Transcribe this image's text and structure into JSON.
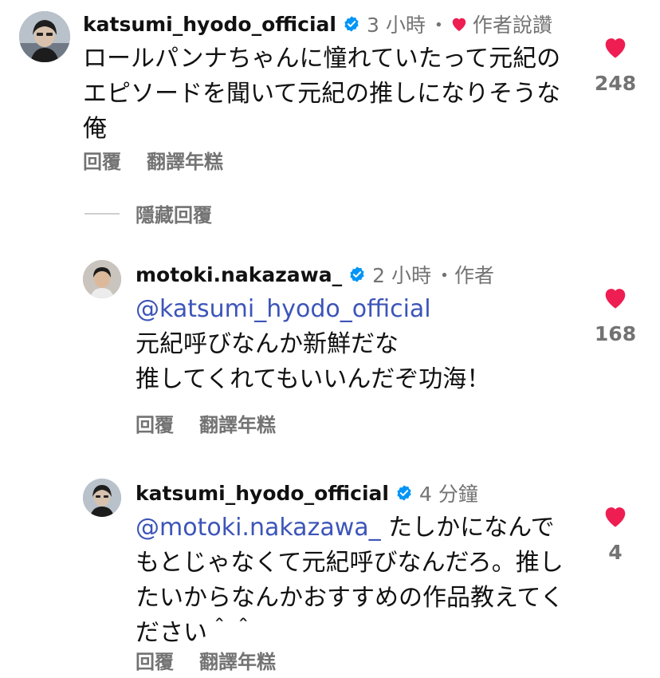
{
  "colors": {
    "heart": "#ee1d52",
    "verified": "#0095f6",
    "mention": "#3d55b8",
    "secondary_text": "#737373"
  },
  "comments": [
    {
      "username": "katsumi_hyodo_official",
      "time": "3 小時",
      "separator": "・",
      "author_liked_label": "作者說讚",
      "text": "ロールパンナちゃんに憧れていたって元紀のエピソードを聞いて元紀の推しになりそうな俺",
      "like_count": "248",
      "reply_label": "回覆",
      "translate_label": "翻譯年糕",
      "hide_replies_label": "隱藏回覆"
    },
    {
      "username": "motoki.nakazawa_",
      "time": "2 小時",
      "separator": "・",
      "author_label": "作者",
      "mention": "@katsumi_hyodo_official",
      "text_line1": "元紀呼びなんか新鮮だな",
      "text_line2": "推してくれてもいいんだぞ功海！",
      "like_count": "168",
      "reply_label": "回覆",
      "translate_label": "翻譯年糕"
    },
    {
      "username": "katsumi_hyodo_official",
      "time": "4 分鐘",
      "mention": "@motoki.nakazawa_",
      "text": "たしかになんでもとじゃなくて元紀呼びなんだろ。推したいからなんかおすすめの作品教えてください＾＾",
      "like_count": "4",
      "reply_label": "回覆",
      "translate_label": "翻譯年糕"
    }
  ]
}
